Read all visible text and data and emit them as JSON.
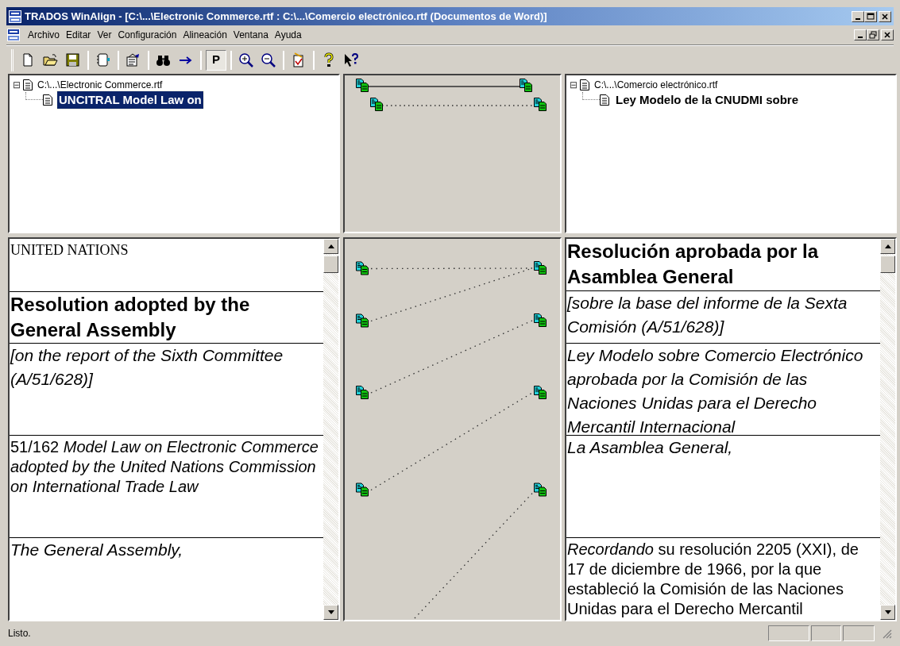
{
  "window": {
    "title": "TRADOS WinAlign - [C:\\...\\Electronic Commerce.rtf : C:\\...\\Comercio electrónico.rtf (Documentos de Word)]"
  },
  "menu": [
    "Archivo",
    "Editar",
    "Ver",
    "Configuración",
    "Alineación",
    "Ventana",
    "Ayuda"
  ],
  "toolbar": [
    {
      "kind": "new"
    },
    {
      "kind": "open"
    },
    {
      "kind": "save"
    },
    {
      "kind": "sep"
    },
    {
      "kind": "book"
    },
    {
      "kind": "sep"
    },
    {
      "kind": "properties"
    },
    {
      "kind": "sep"
    },
    {
      "kind": "find"
    },
    {
      "kind": "arrow"
    },
    {
      "kind": "sep"
    },
    {
      "kind": "text",
      "label": "P",
      "pressed": true
    },
    {
      "kind": "sep"
    },
    {
      "kind": "zoom-in"
    },
    {
      "kind": "zoom-out"
    },
    {
      "kind": "sep"
    },
    {
      "kind": "checklist"
    },
    {
      "kind": "sep"
    },
    {
      "kind": "help"
    },
    {
      "kind": "context-help"
    }
  ],
  "source_tree": {
    "expander": "⊟",
    "label": "C:\\...\\Electronic Commerce.rtf",
    "children": [
      {
        "label": "UNCITRAL Model Law on",
        "selected": true
      }
    ]
  },
  "target_tree": {
    "expander": "⊟",
    "label": "C:\\...\\Comercio electrónico.rtf",
    "children": [
      {
        "label": "Ley Modelo de la CNUDMI sobre",
        "selected": false
      }
    ]
  },
  "source_segments": [
    {
      "kind": "serif",
      "text": "UNITED NATIONS"
    },
    {
      "kind": "heading",
      "text": "Resolution adopted by the General Assembly"
    },
    {
      "kind": "italic",
      "text": "[on the report of the Sixth Committee (A/51/628)]"
    },
    {
      "kind": "mixed",
      "text": "51/162 *Model Law on Electronic Commerce adopted by the United Nations Commission on International Trade Law*"
    },
    {
      "kind": "italic",
      "text": "The General Assembly,"
    }
  ],
  "target_segments": [
    {
      "kind": "heading",
      "text": "Resolución aprobada por la Asamblea General"
    },
    {
      "kind": "italic",
      "text": "[sobre la base del informe de la Sexta Comisión (A/51/628)]"
    },
    {
      "kind": "italic",
      "text": "Ley Modelo sobre Comercio Electrónico aprobada por la Comisión de las Naciones Unidas para el Derecho Mercantil Internacional"
    },
    {
      "kind": "italic",
      "text": "La Asamblea General,"
    },
    {
      "kind": "mixed",
      "text": "*Recordando* su resolución 2205 (XXI), de 17 de diciembre de 1966, por la que estableció la Comisión de las Naciones Unidas para el Derecho Mercantil"
    }
  ],
  "status_bar": {
    "text": "Listo."
  }
}
